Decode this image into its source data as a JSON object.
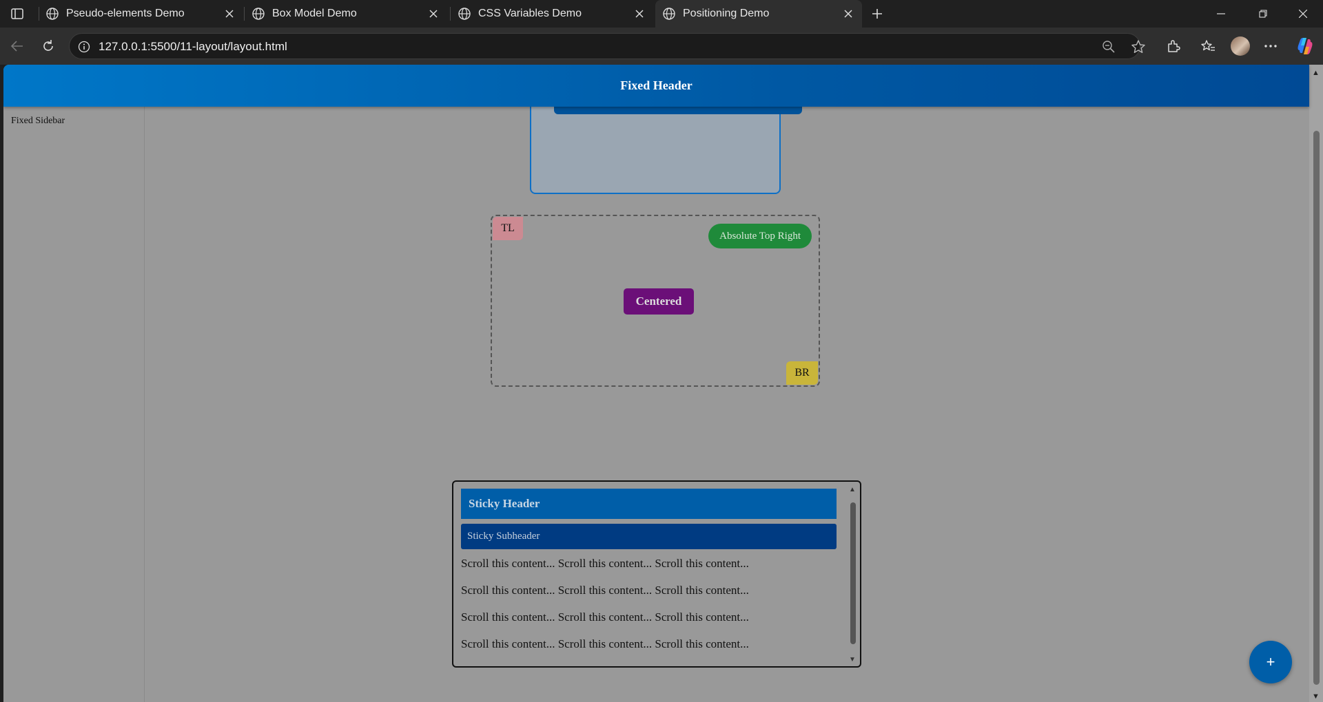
{
  "browser": {
    "tabs": [
      {
        "title": "Pseudo-elements Demo",
        "active": false
      },
      {
        "title": "Box Model Demo",
        "active": false
      },
      {
        "title": "CSS Variables Demo",
        "active": false
      },
      {
        "title": "Positioning Demo",
        "active": true
      }
    ],
    "url": "127.0.0.1:5500/11-layout/layout.html",
    "icons": [
      "tab-actions-icon",
      "globe-icon",
      "close-icon",
      "new-tab-icon",
      "minimize-icon",
      "restore-icon",
      "window-close-icon",
      "back-icon",
      "reload-icon",
      "site-info-icon",
      "zoom-out-icon",
      "favorite-star-icon",
      "extensions-icon",
      "favorites-icon",
      "more-icon",
      "copilot-icon"
    ]
  },
  "page": {
    "header_title": "Fixed Header",
    "sidebar_label": "Fixed Sidebar",
    "absolute_demo": {
      "top_left": "TL",
      "top_right": "Absolute Top Right",
      "center": "Centered",
      "bottom_right": "BR"
    },
    "sticky_demo": {
      "header": "Sticky Header",
      "subheader": "Sticky Subheader",
      "lines": [
        "Scroll this content... Scroll this content... Scroll this content...",
        "Scroll this content... Scroll this content... Scroll this content...",
        "Scroll this content... Scroll this content... Scroll this content...",
        "Scroll this content... Scroll this content... Scroll this content..."
      ]
    },
    "fab_label": "+"
  },
  "colors": {
    "header_start": "#0077c8",
    "header_end": "#004a95",
    "page_bg": "#999999",
    "tl": "#cc8a92",
    "br": "#c9b53a",
    "top_right_pill": "#1f8a3a",
    "centered": "#6b0f78",
    "sticky_header": "#005ea8",
    "sticky_subheader": "#003b82"
  }
}
